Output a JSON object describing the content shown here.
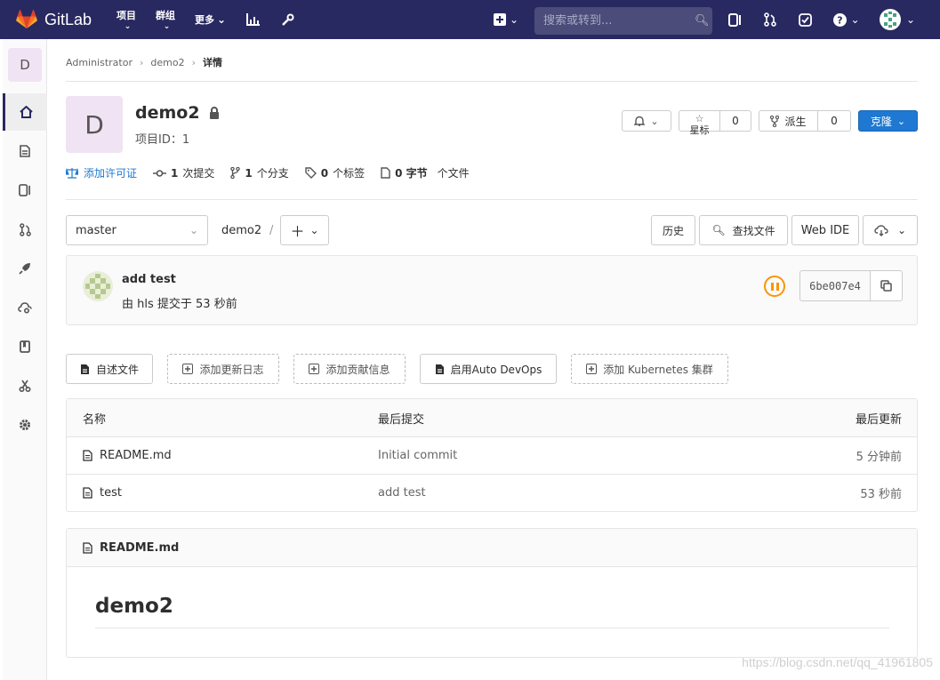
{
  "topbar": {
    "brand": "GitLab",
    "nav": [
      {
        "label": "项目"
      },
      {
        "label": "群组"
      },
      {
        "label": "更多"
      }
    ],
    "search_placeholder": "搜索或转到..."
  },
  "sidebar": {
    "project_letter": "D"
  },
  "breadcrumb": {
    "items": [
      "Administrator",
      "demo2"
    ],
    "current": "详情"
  },
  "project": {
    "letter": "D",
    "name": "demo2",
    "id_label": "项目ID：1",
    "star_label": "星标",
    "star_count": "0",
    "fork_label": "派生",
    "fork_count": "0",
    "clone_label": "克隆"
  },
  "stats": {
    "license": "添加许可证",
    "commits_count": "1",
    "commits_label": "次提交",
    "branches_count": "1",
    "branches_label": "个分支",
    "tags_count": "0",
    "tags_label": "个标签",
    "size_value": "0 字节",
    "files_label": "个文件"
  },
  "repo": {
    "branch": "master",
    "path": "demo2",
    "path_sep": "/",
    "history": "历史",
    "find_file": "查找文件",
    "web_ide": "Web IDE"
  },
  "commit": {
    "title": "add test",
    "meta": "由 hls 提交于 53 秒前",
    "sha": "6be007e4"
  },
  "actions": [
    {
      "label": "自述文件",
      "style": "solid"
    },
    {
      "label": "添加更新日志",
      "style": "dashed"
    },
    {
      "label": "添加贡献信息",
      "style": "dashed"
    },
    {
      "label": "启用Auto DevOps",
      "style": "solid"
    },
    {
      "label": "添加 Kubernetes 集群",
      "style": "dashed"
    }
  ],
  "files": {
    "headers": [
      "名称",
      "最后提交",
      "最后更新"
    ],
    "rows": [
      {
        "name": "README.md",
        "commit": "Initial commit",
        "updated": "5 分钟前"
      },
      {
        "name": "test",
        "commit": "add test",
        "updated": "53 秒前"
      }
    ]
  },
  "readme": {
    "filename": "README.md",
    "heading": "demo2"
  },
  "watermark": "https://blog.csdn.net/qq_41961805",
  "colors": {
    "topbar": "#292961",
    "primary": "#1f78d1",
    "pipeline": "#fc9403"
  }
}
